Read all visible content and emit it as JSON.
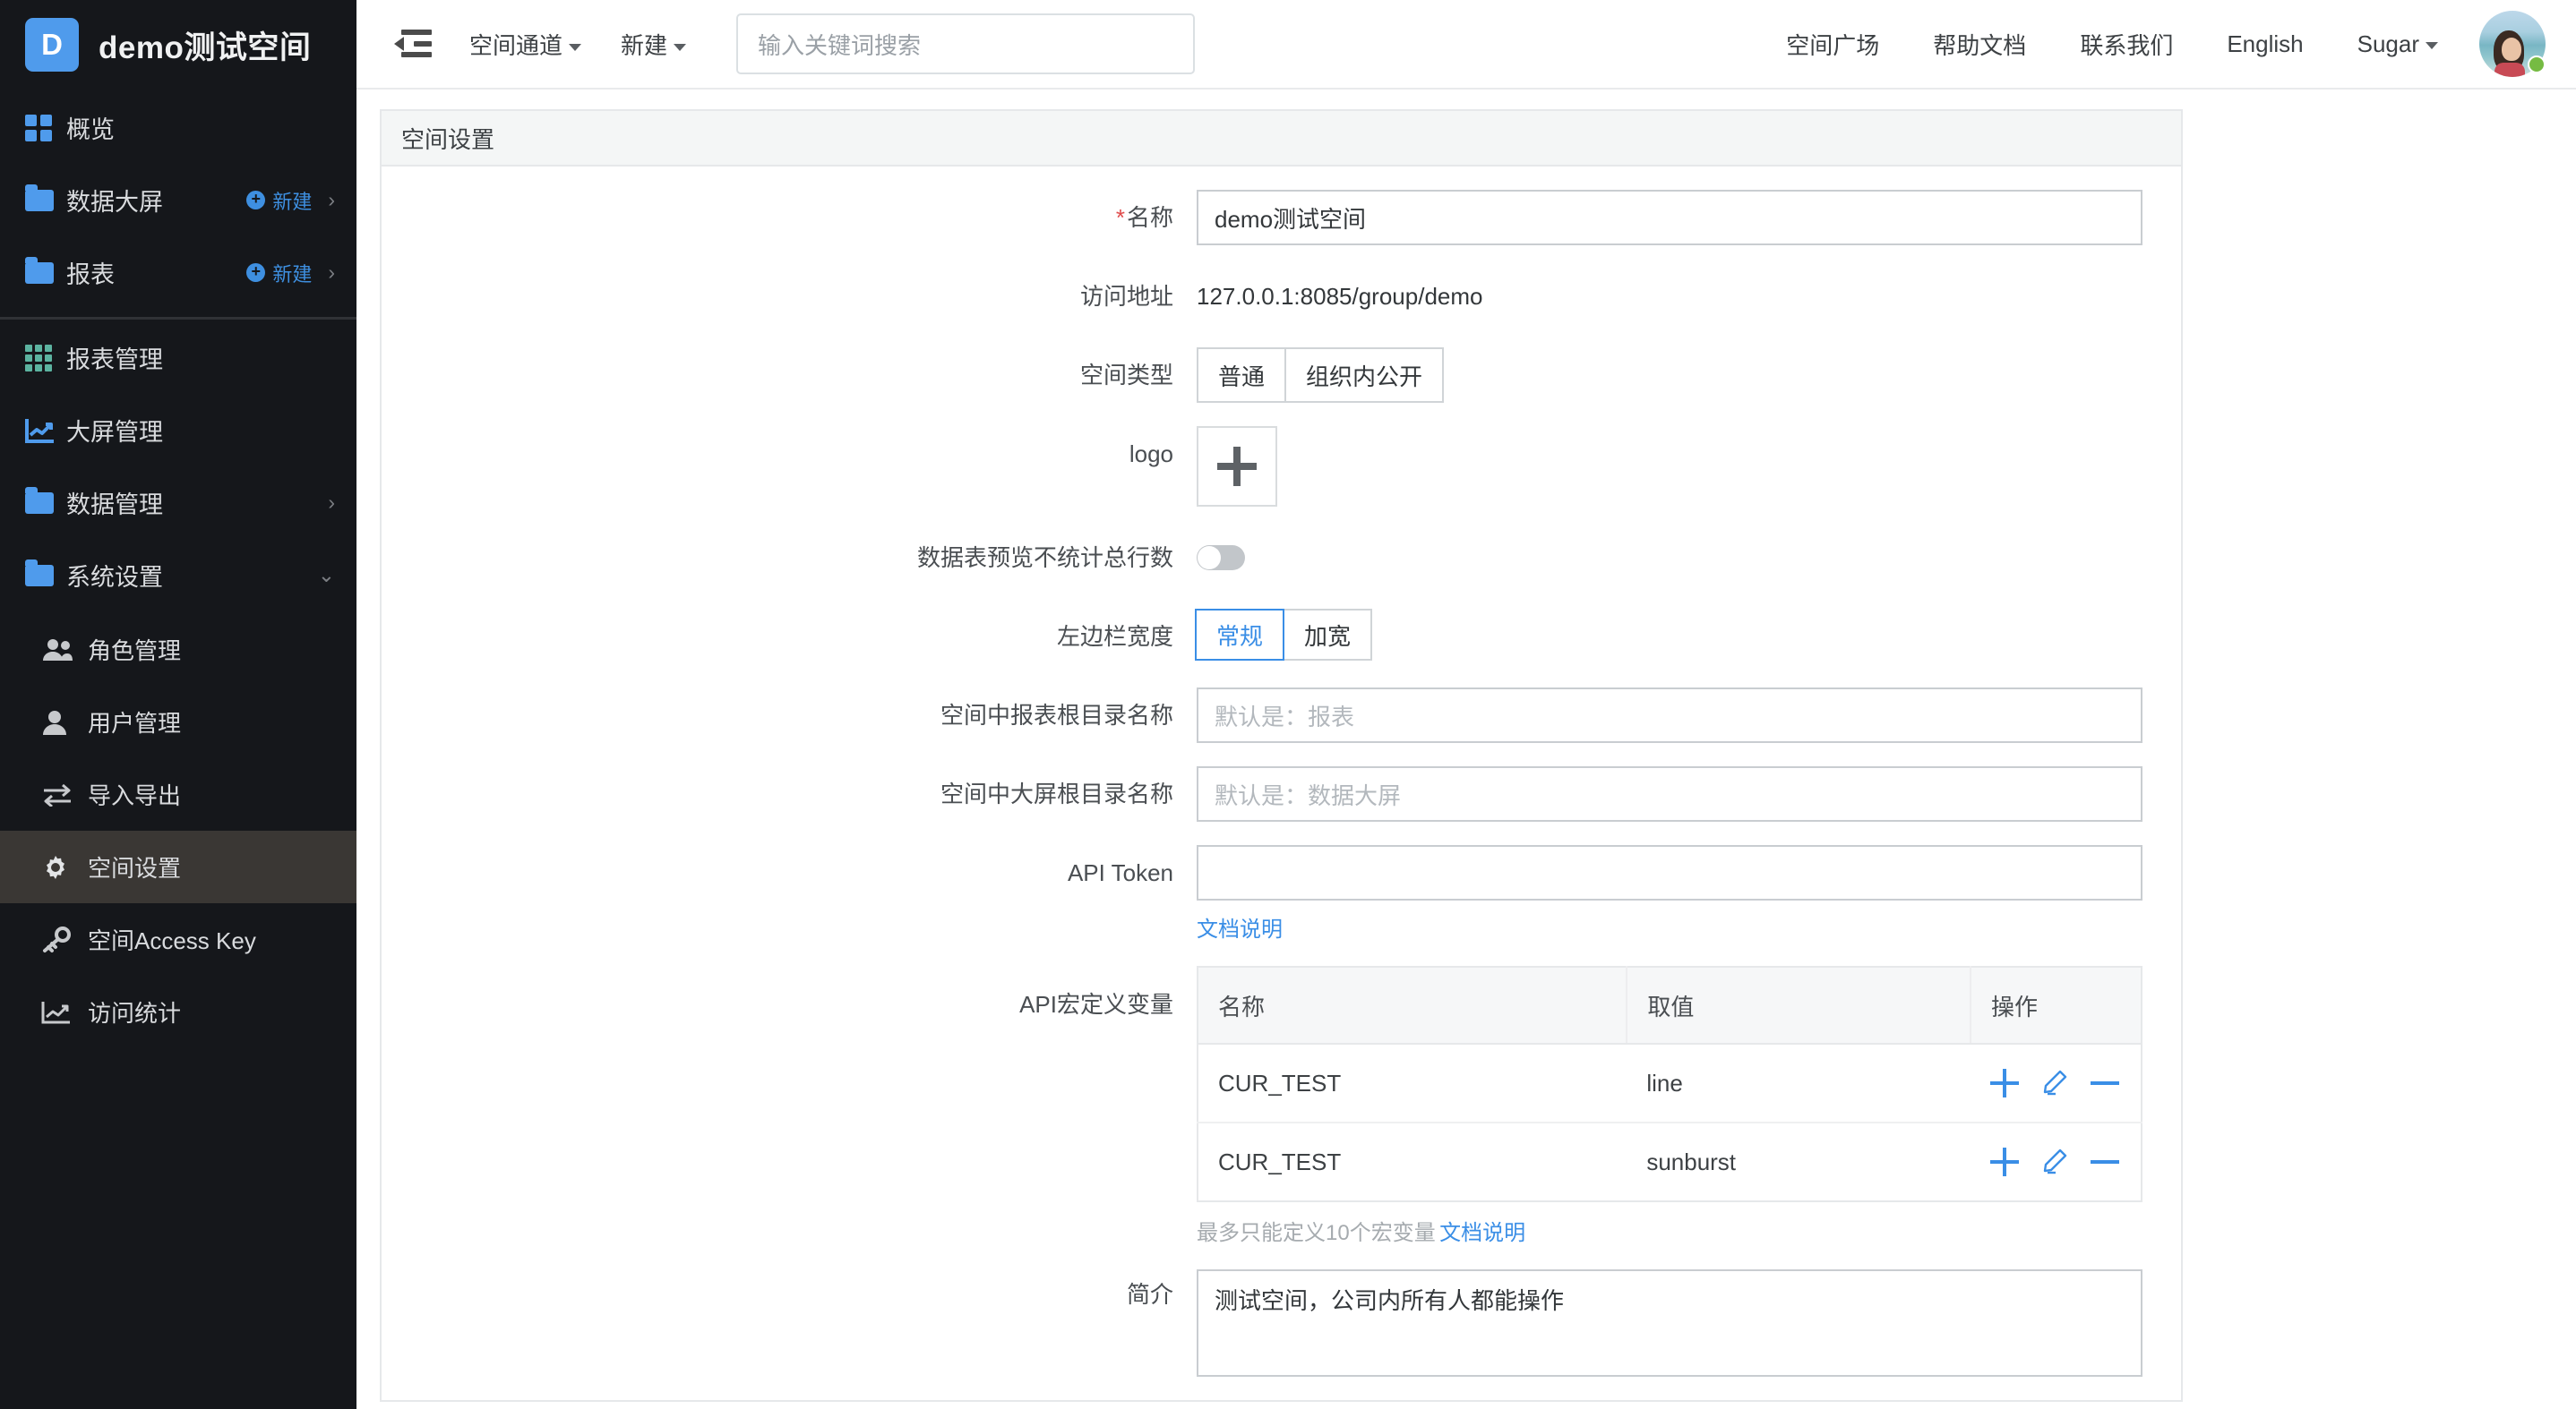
{
  "sidebar": {
    "brand": {
      "initial": "D",
      "title": "demo测试空间"
    },
    "primary": [
      {
        "label": "概览",
        "icon": "grid-4-icon",
        "new_label": null,
        "chevron": null
      },
      {
        "label": "数据大屏",
        "icon": "folder-icon",
        "new_label": "新建",
        "chevron": "›"
      },
      {
        "label": "报表",
        "icon": "folder-icon",
        "new_label": "新建",
        "chevron": "›"
      }
    ],
    "secondary": [
      {
        "label": "报表管理",
        "icon": "grid-9-icon",
        "chevron": null
      },
      {
        "label": "大屏管理",
        "icon": "chart-line-icon",
        "chevron": null
      },
      {
        "label": "数据管理",
        "icon": "folder-icon",
        "chevron": "›"
      },
      {
        "label": "系统设置",
        "icon": "folder-icon",
        "chevron": "⌄"
      }
    ],
    "sub_items": [
      {
        "label": "角色管理",
        "icon": "users-icon",
        "selected": false
      },
      {
        "label": "用户管理",
        "icon": "user-icon",
        "selected": false
      },
      {
        "label": "导入导出",
        "icon": "transfer-icon",
        "selected": false
      },
      {
        "label": "空间设置",
        "icon": "gear-icon",
        "selected": true
      },
      {
        "label": "空间Access Key",
        "icon": "key-icon",
        "selected": false
      },
      {
        "label": "访问统计",
        "icon": "chart-line-icon",
        "selected": false
      }
    ]
  },
  "topbar": {
    "collapse_icon": "collapse-sidebar-icon",
    "left_links": [
      {
        "label": "空间通道",
        "caret": true
      },
      {
        "label": "新建",
        "caret": true
      }
    ],
    "search_placeholder": "输入关键词搜索",
    "right_links": [
      {
        "label": "空间广场",
        "caret": false
      },
      {
        "label": "帮助文档",
        "caret": false
      },
      {
        "label": "联系我们",
        "caret": false
      },
      {
        "label": "English",
        "caret": false
      },
      {
        "label": "Sugar",
        "caret": true
      }
    ],
    "avatar": {
      "name": "avatar",
      "status": "online"
    }
  },
  "page": {
    "card_title": "空间设置",
    "fields": {
      "name_label": "名称",
      "name_required": "*",
      "name_value": "demo测试空间",
      "url_label": "访问地址",
      "url_value": "127.0.0.1:8085/group/demo",
      "space_type_label": "空间类型",
      "space_type_options": [
        "普通",
        "组织内公开"
      ],
      "logo_label": "logo",
      "logo_upload_icon": "plus-icon",
      "preview_label": "数据表预览不统计总行数",
      "preview_enabled": false,
      "sidebar_width_label": "左边栏宽度",
      "sidebar_width_options": [
        "常规",
        "加宽"
      ],
      "sidebar_width_selected": "常规",
      "report_root_label": "空间中报表根目录名称",
      "report_root_placeholder": "默认是：报表",
      "report_root_value": "",
      "screen_root_label": "空间中大屏根目录名称",
      "screen_root_placeholder": "默认是：数据大屏",
      "screen_root_value": "",
      "api_token_label": "API Token",
      "api_token_value": "",
      "api_token_doclink": "文档说明",
      "macro_label": "API宏定义变量",
      "macro_hint": "最多只能定义10个宏变量",
      "macro_hint_doclink": "文档说明",
      "intro_label": "简介",
      "intro_value": "测试空间，公司内所有人都能操作"
    },
    "macro_table": {
      "headers": [
        "名称",
        "取值",
        "操作"
      ],
      "rows": [
        {
          "name": "CUR_TEST",
          "value": "line"
        },
        {
          "name": "CUR_TEST",
          "value": "sunburst"
        }
      ],
      "op_icons": [
        "plus-icon",
        "edit-pencil-icon",
        "minus-icon"
      ]
    }
  },
  "colors": {
    "sidebar_bg": "#15171b",
    "accent_blue": "#3a8ee6",
    "brand_blue": "#4f9bec",
    "teal": "#5cb3a0",
    "selected_row": "#3a3734",
    "required_red": "#e04b4b",
    "status_green": "#76bb43"
  }
}
